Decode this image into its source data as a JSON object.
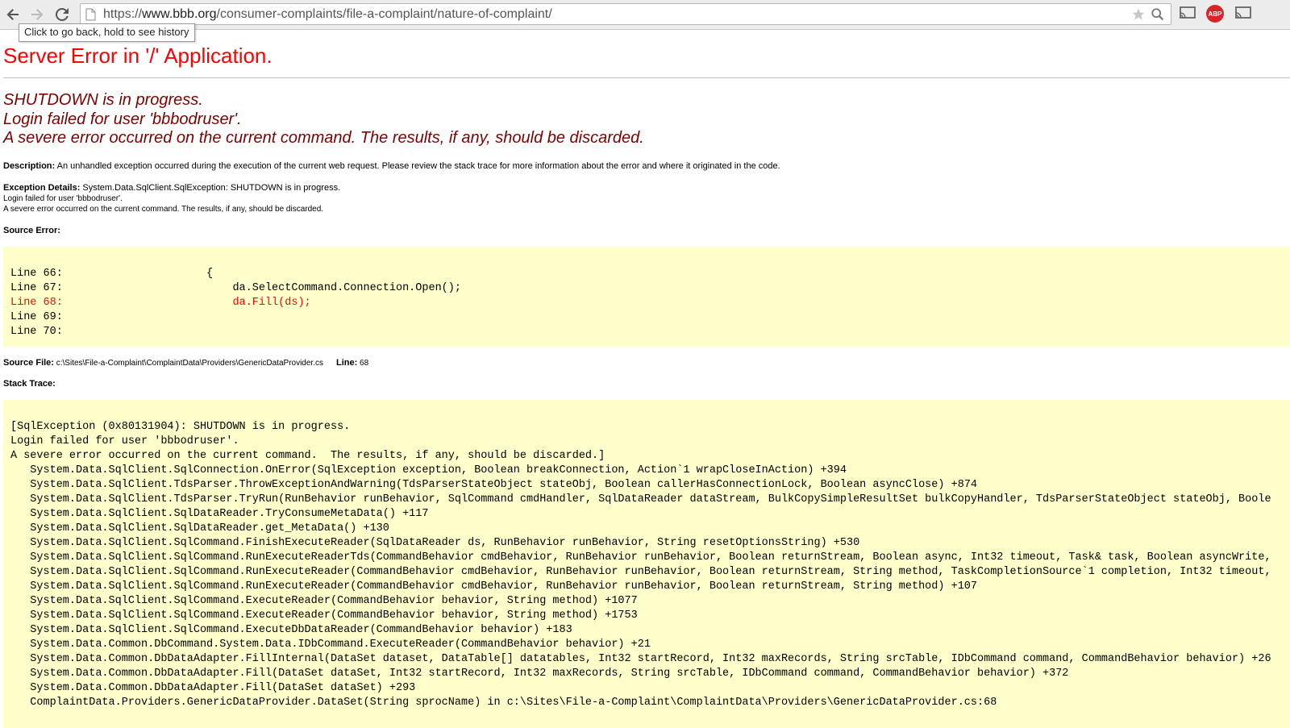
{
  "browser": {
    "url_prefix": "https://",
    "url_host": "www.bbb.org",
    "url_path": "/consumer-complaints/file-a-complaint/nature-of-complaint/",
    "tooltip": "Click to go back, hold to see history",
    "abp_label": "ABP"
  },
  "page": {
    "title": "Server Error in '/' Application.",
    "messages": [
      "SHUTDOWN is in progress.",
      "Login failed for user 'bbbodruser'.",
      "A severe error occurred on the current command.  The results, if any, should be discarded."
    ],
    "description_label": "Description:",
    "description_text": " An unhandled exception occurred during the execution of the current web request. Please review the stack trace for more information about the error and where it originated in the code.",
    "exception_label": "Exception Details:",
    "exception_text": " System.Data.SqlClient.SqlException: SHUTDOWN is in progress.",
    "exception_line2": "Login failed for user 'bbbodruser'.",
    "exception_line3": "A severe error occurred on the current command.  The results, if any, should be discarded.",
    "source_error_label": "Source Error:",
    "source_lines": [
      "Line 66:                      {",
      "Line 67:                          da.SelectCommand.Connection.Open();",
      "Line 68:                          da.Fill(ds);",
      "Line 69:",
      "Line 70:"
    ],
    "source_file_label": "Source File:",
    "source_file_value": " c:\\Sites\\File-a-Complaint\\ComplaintData\\Providers\\GenericDataProvider.cs",
    "line_label": "Line:",
    "line_value": " 68",
    "stack_trace_label": "Stack Trace:",
    "stack_lines": [
      "[SqlException (0x80131904): SHUTDOWN is in progress.",
      "Login failed for user 'bbbodruser'.",
      "A severe error occurred on the current command.  The results, if any, should be discarded.]",
      "   System.Data.SqlClient.SqlConnection.OnError(SqlException exception, Boolean breakConnection, Action`1 wrapCloseInAction) +394",
      "   System.Data.SqlClient.TdsParser.ThrowExceptionAndWarning(TdsParserStateObject stateObj, Boolean callerHasConnectionLock, Boolean asyncClose) +874",
      "   System.Data.SqlClient.TdsParser.TryRun(RunBehavior runBehavior, SqlCommand cmdHandler, SqlDataReader dataStream, BulkCopySimpleResultSet bulkCopyHandler, TdsParserStateObject stateObj, Boole",
      "   System.Data.SqlClient.SqlDataReader.TryConsumeMetaData() +117",
      "   System.Data.SqlClient.SqlDataReader.get_MetaData() +130",
      "   System.Data.SqlClient.SqlCommand.FinishExecuteReader(SqlDataReader ds, RunBehavior runBehavior, String resetOptionsString) +530",
      "   System.Data.SqlClient.SqlCommand.RunExecuteReaderTds(CommandBehavior cmdBehavior, RunBehavior runBehavior, Boolean returnStream, Boolean async, Int32 timeout, Task& task, Boolean asyncWrite,",
      "   System.Data.SqlClient.SqlCommand.RunExecuteReader(CommandBehavior cmdBehavior, RunBehavior runBehavior, Boolean returnStream, String method, TaskCompletionSource`1 completion, Int32 timeout,",
      "   System.Data.SqlClient.SqlCommand.RunExecuteReader(CommandBehavior cmdBehavior, RunBehavior runBehavior, Boolean returnStream, String method) +107",
      "   System.Data.SqlClient.SqlCommand.ExecuteReader(CommandBehavior behavior, String method) +1077",
      "   System.Data.SqlClient.SqlCommand.ExecuteReader(CommandBehavior behavior, String method) +1753",
      "   System.Data.SqlClient.SqlCommand.ExecuteDbDataReader(CommandBehavior behavior) +183",
      "   System.Data.Common.DbCommand.System.Data.IDbCommand.ExecuteReader(CommandBehavior behavior) +21",
      "   System.Data.Common.DbDataAdapter.FillInternal(DataSet dataset, DataTable[] datatables, Int32 startRecord, Int32 maxRecords, String srcTable, IDbCommand command, CommandBehavior behavior) +26",
      "   System.Data.Common.DbDataAdapter.Fill(DataSet dataSet, Int32 startRecord, Int32 maxRecords, String srcTable, IDbCommand command, CommandBehavior behavior) +372",
      "   System.Data.Common.DbDataAdapter.Fill(DataSet dataSet) +293",
      "   ComplaintData.Providers.GenericDataProvider.DataSet(String sprocName) in c:\\Sites\\File-a-Complaint\\ComplaintData\\Providers\\GenericDataProvider.cs:68"
    ]
  }
}
